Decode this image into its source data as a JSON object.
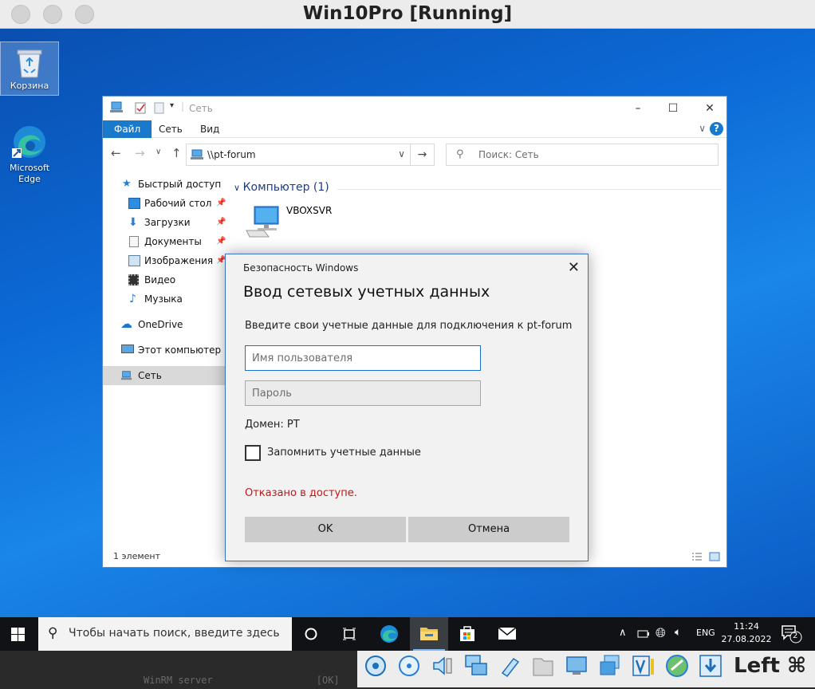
{
  "host": {
    "title": "Win10Pro [Running]",
    "host_key": "Left ⌘",
    "terminal_text": "WinRM server                  [OK]"
  },
  "desktop": {
    "icons": [
      {
        "label": "Корзина",
        "icon": "recycle-bin-icon"
      },
      {
        "label": "Microsoft Edge",
        "icon": "edge-icon"
      }
    ]
  },
  "explorer": {
    "title": "Сеть",
    "ribbon_tabs": [
      "Файл",
      "Сеть",
      "Вид"
    ],
    "address": "\\\\pt-forum",
    "search_placeholder": "Поиск: Сеть",
    "nav": [
      {
        "label": "Быстрый доступ",
        "icon": "star-icon"
      },
      {
        "label": "Рабочий стол",
        "icon": "desktop-icon",
        "pinned": true
      },
      {
        "label": "Загрузки",
        "icon": "download-icon",
        "pinned": true
      },
      {
        "label": "Документы",
        "icon": "documents-icon",
        "pinned": true
      },
      {
        "label": "Изображения",
        "icon": "pictures-icon",
        "pinned": true
      },
      {
        "label": "Видео",
        "icon": "video-icon"
      },
      {
        "label": "Музыка",
        "icon": "music-icon"
      },
      {
        "label": "OneDrive",
        "icon": "cloud-icon"
      },
      {
        "label": "Этот компьютер",
        "icon": "computer-icon"
      },
      {
        "label": "Сеть",
        "icon": "network-icon",
        "selected": true
      }
    ],
    "group_header": "Компьютер (1)",
    "items": [
      {
        "label": "VBOXSVR",
        "icon": "network-computer-icon"
      }
    ],
    "status": "1 элемент"
  },
  "dialog": {
    "caption": "Безопасность Windows",
    "heading": "Ввод сетевых учетных данных",
    "description": "Введите свои учетные данные для подключения к pt-forum",
    "username_placeholder": "Имя пользователя",
    "password_placeholder": "Пароль",
    "domain": "Домен: PT",
    "remember_label": "Запомнить учетные данные",
    "remember_checked": false,
    "error": "Отказано в доступе.",
    "ok_label": "OK",
    "cancel_label": "Отмена",
    "error_color": "#c51616",
    "accent_color": "#1a6fd0"
  },
  "taskbar": {
    "search_placeholder": "Чтобы начать поиск, введите здесь",
    "language": "ENG",
    "time": "11:24",
    "date": "27.08.2022",
    "notification_count": "2"
  }
}
